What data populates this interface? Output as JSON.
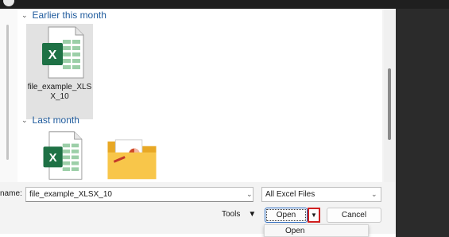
{
  "groups": [
    {
      "label": "Earlier this month"
    },
    {
      "label": "Last month"
    }
  ],
  "files": [
    {
      "name": "file_example_XLSX_10",
      "icon": "excel-file-icon",
      "selected": true
    },
    {
      "name": "",
      "icon": "excel-file-icon"
    },
    {
      "name": "",
      "icon": "folder-icon"
    }
  ],
  "footer": {
    "filename_label": "name:",
    "filename_value": "file_example_XLSX_10",
    "filter_value": "All Excel Files",
    "tools_label": "Tools",
    "open_label": "Open",
    "cancel_label": "Cancel"
  },
  "open_menu": {
    "items": [
      "Open"
    ]
  },
  "colors": {
    "excel_green": "#1e7145",
    "group_header": "#1e5a9c",
    "highlight_red": "#d02020"
  }
}
